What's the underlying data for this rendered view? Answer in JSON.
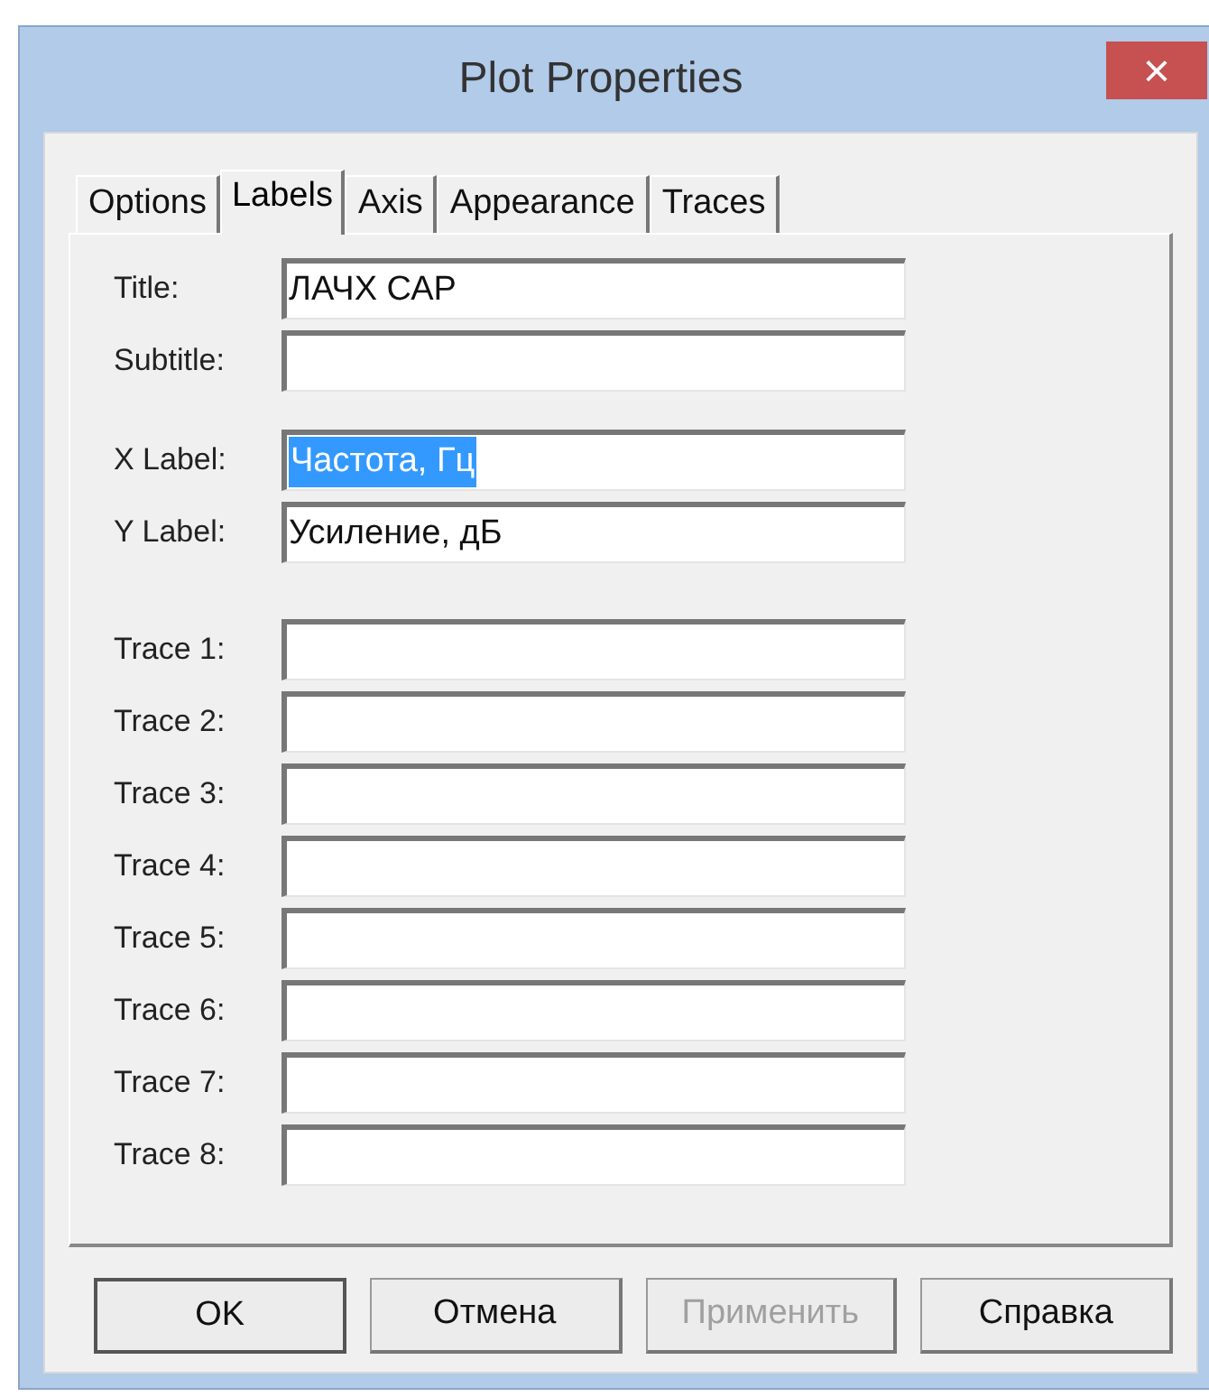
{
  "window": {
    "title": "Plot Properties",
    "close": "×"
  },
  "tabs": [
    {
      "label": "Options",
      "selected": false
    },
    {
      "label": "Labels",
      "selected": true
    },
    {
      "label": "Axis",
      "selected": false
    },
    {
      "label": "Appearance",
      "selected": false
    },
    {
      "label": "Traces",
      "selected": false
    }
  ],
  "groups": [
    [
      {
        "label": "Title:",
        "value": "ЛАЧХ САР",
        "highlighted": false
      },
      {
        "label": "Subtitle:"
      }
    ],
    [
      {
        "label": "X Label:",
        "value": "Частота, Гц",
        "highlighted": true
      },
      {
        "label": "Y Label:",
        "value": "Усиление, дБ",
        "highlighted": false
      }
    ],
    [
      {
        "label": "Trace 1:"
      },
      {
        "label": "Trace 2:"
      },
      {
        "label": "Trace 3:"
      },
      {
        "label": "Trace 4:"
      },
      {
        "label": "Trace 5:"
      },
      {
        "label": "Trace 6:"
      },
      {
        "label": "Trace 7:"
      },
      {
        "label": "Trace 8:"
      }
    ]
  ],
  "buttons": [
    {
      "label": "OK",
      "default": true,
      "disabled": false
    },
    {
      "label": "Отмена",
      "default": false,
      "disabled": false
    },
    {
      "label": "Применить",
      "default": false,
      "disabled": true
    },
    {
      "label": "Справка",
      "default": false,
      "disabled": false
    }
  ]
}
